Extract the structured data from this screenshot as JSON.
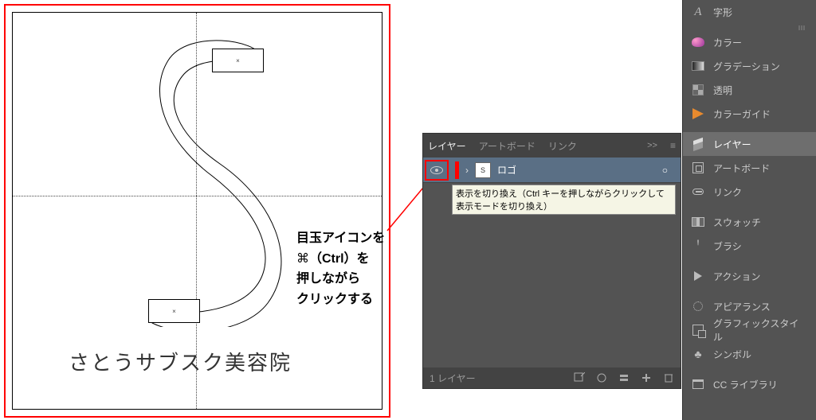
{
  "canvas": {
    "logo_text": "さとうサブスク美容院",
    "anchor_mark": "×"
  },
  "annotation": {
    "line1": "目玉アイコンを",
    "line2_prefix": "⌘",
    "line2_suffix": "（Ctrl）を",
    "line3": "押しながら",
    "line4": "クリックする"
  },
  "layers_panel": {
    "tabs": {
      "layers": "レイヤー",
      "artboard": "アートボード",
      "links": "リンク"
    },
    "expand_icon": ">> ",
    "menu_icon": "≡",
    "layer": {
      "chevron": "›",
      "name": "ロゴ",
      "circle": "○",
      "thumb_text": "S"
    },
    "tooltip": "表示を切り換え（Ctrl キーを押しながらクリックして表示モードを切り換え）",
    "footer": {
      "count": "1 レイヤー"
    }
  },
  "sidebar": {
    "type": "字形",
    "color": "カラー",
    "gradient": "グラデーション",
    "transparency": "透明",
    "color_guide": "カラーガイド",
    "layers": "レイヤー",
    "artboard": "アートボード",
    "links": "リンク",
    "swatches": "スウォッチ",
    "brushes": "ブラシ",
    "actions": "アクション",
    "appearance": "アピアランス",
    "graphic_styles": "グラフィックスタイル",
    "symbols": "シンボル",
    "cc_libraries": "CC ライブラリ"
  }
}
